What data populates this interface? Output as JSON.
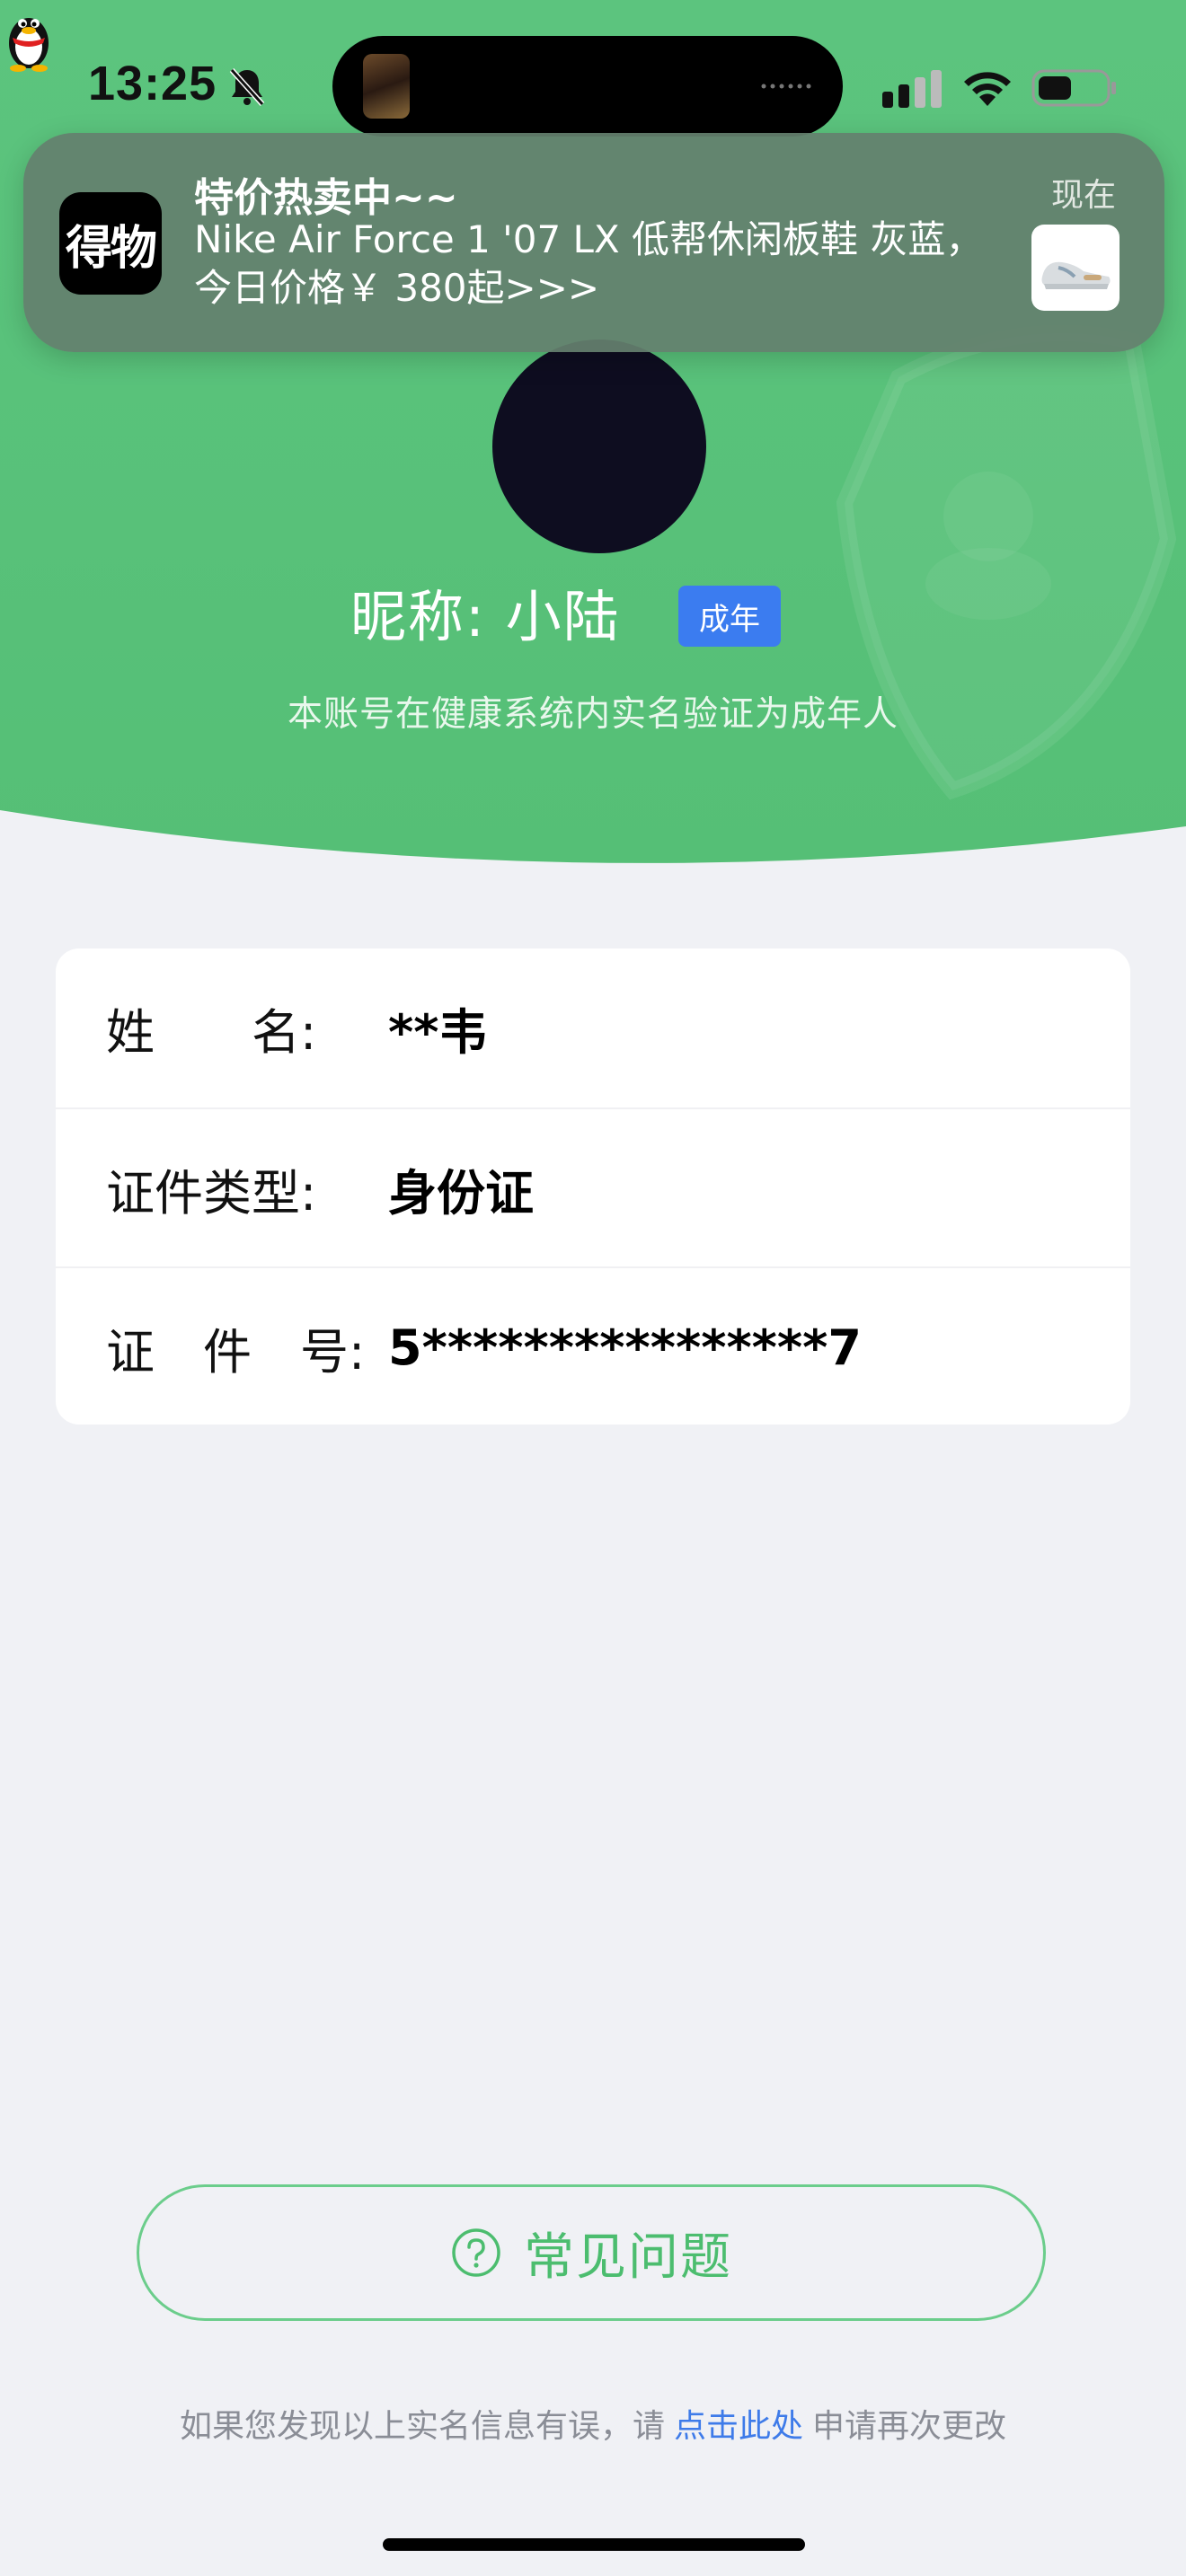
{
  "status_bar": {
    "time": "13:25"
  },
  "notification": {
    "app_icon_text": "得物",
    "title": "特价热卖中~~",
    "body": "Nike Air Force 1 '07 LX 低帮休闲板鞋 灰蓝，今日价格￥ 380起>>>",
    "time": "现在"
  },
  "profile": {
    "nickname": "昵称:  小陆",
    "badge": "成年",
    "verify_note": "本账号在健康系统内实名验证为成年人"
  },
  "info_rows": [
    {
      "label": "姓　　名:",
      "value": "**韦"
    },
    {
      "label": "证件类型:",
      "value": "身份证"
    },
    {
      "label": "证　件　号:",
      "value": "5****************7"
    }
  ],
  "faq_button": {
    "label": "常见问题"
  },
  "footer": {
    "prefix": "如果您发现以上实名信息有误，请",
    "link": "点击此处",
    "suffix": "申请再次更改"
  },
  "colors": {
    "hero_green": "#5ac47c",
    "badge_blue": "#3b7cf0",
    "faq_green": "#4cbd6f",
    "link_blue": "#3e7be9"
  }
}
